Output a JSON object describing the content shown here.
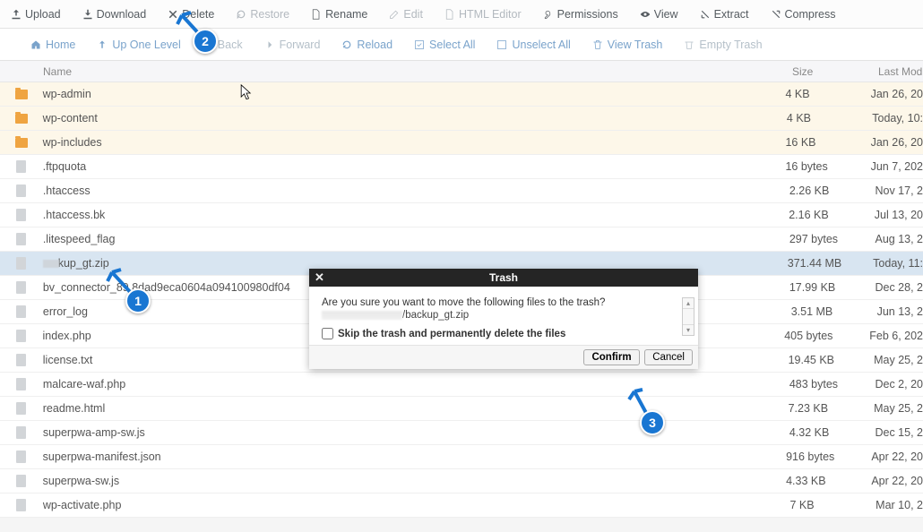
{
  "toolbar1": {
    "upload": "Upload",
    "download": "Download",
    "delete": "Delete",
    "restore": "Restore",
    "rename": "Rename",
    "edit": "Edit",
    "html_editor": "HTML Editor",
    "permissions": "Permissions",
    "view": "View",
    "extract": "Extract",
    "compress": "Compress"
  },
  "toolbar2": {
    "home": "Home",
    "up": "Up One Level",
    "back": "Back",
    "forward": "Forward",
    "reload": "Reload",
    "select_all": "Select All",
    "unselect_all": "Unselect All",
    "view_trash": "View Trash",
    "empty_trash": "Empty Trash"
  },
  "headers": {
    "name": "Name",
    "size": "Size",
    "last_modified": "Last Mod"
  },
  "files": [
    {
      "name": "wp-admin",
      "type": "folder",
      "size": "4 KB",
      "lm": "Jan 26, 20"
    },
    {
      "name": "wp-content",
      "type": "folder",
      "size": "4 KB",
      "lm": "Today, 10:"
    },
    {
      "name": "wp-includes",
      "type": "folder",
      "size": "16 KB",
      "lm": "Jan 26, 20"
    },
    {
      "name": ".ftpquota",
      "type": "file",
      "size": "16 bytes",
      "lm": "Jun 7, 202"
    },
    {
      "name": ".htaccess",
      "type": "file",
      "size": "2.26 KB",
      "lm": "Nov 17, 2"
    },
    {
      "name": ".htaccess.bk",
      "type": "file",
      "size": "2.16 KB",
      "lm": "Jul 13, 20"
    },
    {
      "name": ".litespeed_flag",
      "type": "file",
      "size": "297 bytes",
      "lm": "Aug 13, 2"
    },
    {
      "name": "kup_gt.zip",
      "type": "zip",
      "size": "371.44 MB",
      "lm": "Today, 11:",
      "selected": true,
      "prefix_blur": true
    },
    {
      "name": "bv_connector_89      8dad9eca0604a094100980df04",
      "type": "file",
      "size": "17.99 KB",
      "lm": "Dec 28, 2"
    },
    {
      "name": "error_log",
      "type": "file",
      "size": "3.51 MB",
      "lm": "Jun 13, 2"
    },
    {
      "name": "index.php",
      "type": "php",
      "size": "405 bytes",
      "lm": "Feb 6, 202"
    },
    {
      "name": "license.txt",
      "type": "file",
      "size": "19.45 KB",
      "lm": "May 25, 2"
    },
    {
      "name": "malcare-waf.php",
      "type": "php",
      "size": "483 bytes",
      "lm": "Dec 2, 20"
    },
    {
      "name": "readme.html",
      "type": "file",
      "size": "7.23 KB",
      "lm": "May 25, 2"
    },
    {
      "name": "superpwa-amp-sw.js",
      "type": "file",
      "size": "4.32 KB",
      "lm": "Dec 15, 2"
    },
    {
      "name": "superpwa-manifest.json",
      "type": "file",
      "size": "916 bytes",
      "lm": "Apr 22, 20"
    },
    {
      "name": "superpwa-sw.js",
      "type": "file",
      "size": "4.33 KB",
      "lm": "Apr 22, 20"
    },
    {
      "name": "wp-activate.php",
      "type": "php",
      "size": "7 KB",
      "lm": "Mar 10, 2"
    }
  ],
  "modal": {
    "title": "Trash",
    "question": "Are you sure you want to move the following files to the trash?",
    "filepath_suffix": "/backup_gt.zip",
    "skip": "Skip the trash and permanently delete the files",
    "confirm": "Confirm",
    "cancel": "Cancel"
  }
}
